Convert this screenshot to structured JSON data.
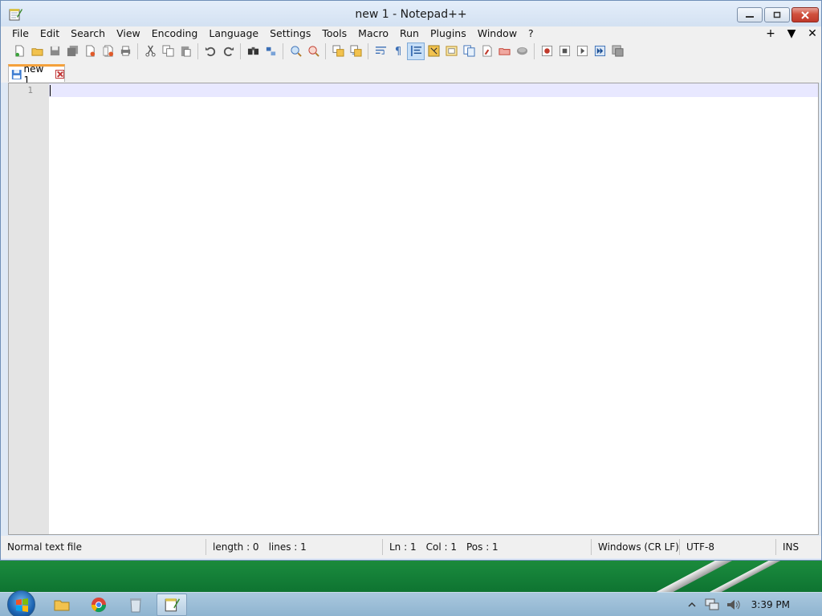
{
  "window": {
    "title": "new 1 - Notepad++",
    "icon": "notepadpp-icon"
  },
  "menu": {
    "items": [
      "File",
      "Edit",
      "Search",
      "View",
      "Encoding",
      "Language",
      "Settings",
      "Tools",
      "Macro",
      "Run",
      "Plugins",
      "Window",
      "?"
    ],
    "right_controls": [
      "+",
      "▼",
      "✕"
    ]
  },
  "toolbar": {
    "groups": [
      [
        "new-file-icon",
        "open-file-icon",
        "save-icon",
        "save-all-icon",
        "close-icon",
        "close-all-icon",
        "print-icon"
      ],
      [
        "cut-icon",
        "copy-icon",
        "paste-icon"
      ],
      [
        "undo-icon",
        "redo-icon"
      ],
      [
        "find-icon",
        "replace-icon"
      ],
      [
        "zoom-in-icon",
        "zoom-out-icon"
      ],
      [
        "sync-vertical-icon",
        "sync-horizontal-icon"
      ],
      [
        "word-wrap-icon",
        "show-all-characters-icon",
        "indent-guide-icon",
        "user-defined-language-icon",
        "document-map-icon",
        "function-list-icon",
        "folder-as-workspace-icon",
        "monitoring-icon"
      ],
      [
        "record-macro-icon",
        "stop-recording-icon",
        "playback-macro-icon",
        "run-macro-multiple-icon",
        "save-macro-icon"
      ]
    ],
    "active": "indent-guide-icon"
  },
  "tabs": [
    {
      "label": "new 1",
      "icon": "saved-file-icon",
      "close_icon": "tab-close-icon",
      "active": true
    }
  ],
  "editor": {
    "lines": [
      ""
    ],
    "line_numbers": [
      "1"
    ]
  },
  "status": {
    "file_type": "Normal text file",
    "length": "length : 0",
    "lines": "lines : 1",
    "ln": "Ln : 1",
    "col": "Col : 1",
    "pos": "Pos : 1",
    "eol": "Windows (CR LF)",
    "encoding": "UTF-8",
    "mode": "INS"
  },
  "taskbar": {
    "apps": [
      "file-explorer-icon",
      "chrome-icon",
      "recycle-bin-icon",
      "notepadpp-icon"
    ],
    "active_app": "notepadpp-icon",
    "tray_icons": [
      "show-hidden-icons-icon",
      "network-icon",
      "volume-icon"
    ],
    "clock": "3:39 PM"
  },
  "colors": {
    "tab_accent": "#f4a13b",
    "caret_line": "#e8e8ff",
    "close_button": "#c0392b",
    "record": "#c0392b"
  }
}
